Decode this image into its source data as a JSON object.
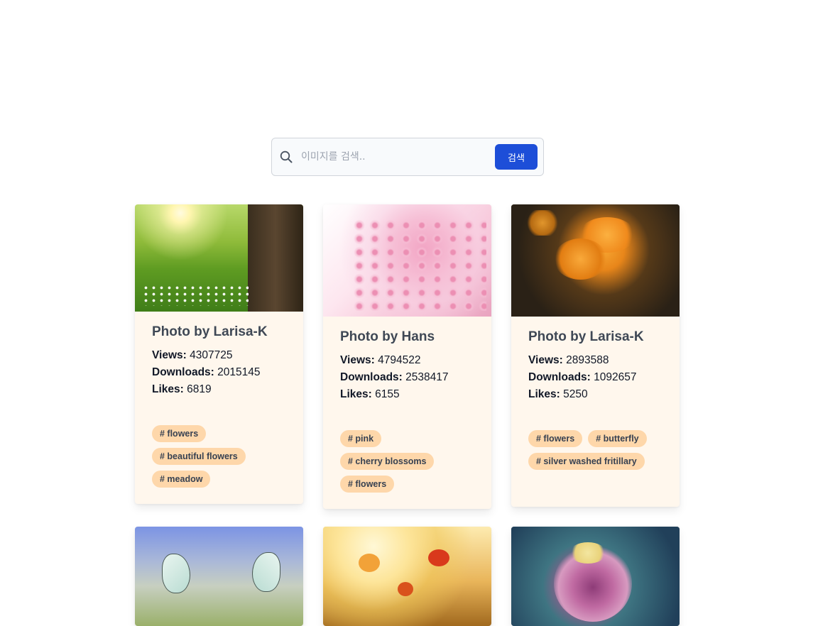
{
  "search": {
    "placeholder": "이미지를 검색..",
    "button_label": "검색"
  },
  "cards": [
    {
      "title": "Photo by Larisa-K",
      "views_label": "Views:",
      "views": "4307725",
      "downloads_label": "Downloads:",
      "downloads": "2015145",
      "likes_label": "Likes:",
      "likes": "6819",
      "tags": [
        "# flowers",
        "# beautiful flowers",
        "# meadow"
      ]
    },
    {
      "title": "Photo by Hans",
      "views_label": "Views:",
      "views": "4794522",
      "downloads_label": "Downloads:",
      "downloads": "2538417",
      "likes_label": "Likes:",
      "likes": "6155",
      "tags": [
        "# pink",
        "# cherry blossoms",
        "# flowers"
      ]
    },
    {
      "title": "Photo by Larisa-K",
      "views_label": "Views:",
      "views": "2893588",
      "downloads_label": "Downloads:",
      "downloads": "1092657",
      "likes_label": "Likes:",
      "likes": "5250",
      "tags": [
        "# flowers",
        "# butterfly",
        "# silver washed fritillary"
      ]
    }
  ],
  "colors": {
    "accent": "#1d4ed8",
    "card_background": "#fff7ed",
    "tag_background": "#fed7aa",
    "title_text": "#3f4855"
  }
}
